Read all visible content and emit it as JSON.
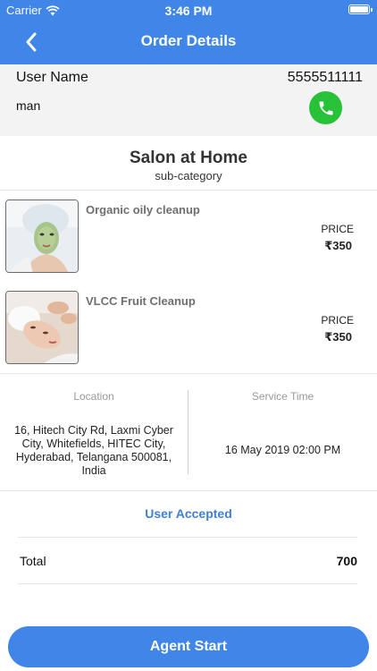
{
  "status_bar": {
    "carrier": "Carrier",
    "time": "3:46 PM"
  },
  "nav": {
    "title": "Order Details"
  },
  "user": {
    "label": "User Name",
    "phone": "5555511111",
    "name": "man"
  },
  "category": {
    "title": "Salon at Home",
    "subtitle": "sub-category"
  },
  "items": [
    {
      "name": "Organic oily cleanup",
      "price_label": "PRICE",
      "price": "₹350"
    },
    {
      "name": "VLCC Fruit Cleanup",
      "price_label": "PRICE",
      "price": "₹350"
    }
  ],
  "location": {
    "label": "Location",
    "lines": [
      "16, Hitech City Rd, Laxmi Cyber",
      "City, Whitefields, HITEC City,",
      "Hyderabad, Telangana 500081,",
      "India"
    ]
  },
  "service_time": {
    "label": "Service Time",
    "value": "16 May 2019 02:00 PM"
  },
  "order_status": "User Accepted",
  "total": {
    "label": "Total",
    "value": "700"
  },
  "action": {
    "label": "Agent Start"
  },
  "colors": {
    "primary": "#3f86e8",
    "call_green": "#28c238",
    "status_blue": "#3f7fd8"
  }
}
